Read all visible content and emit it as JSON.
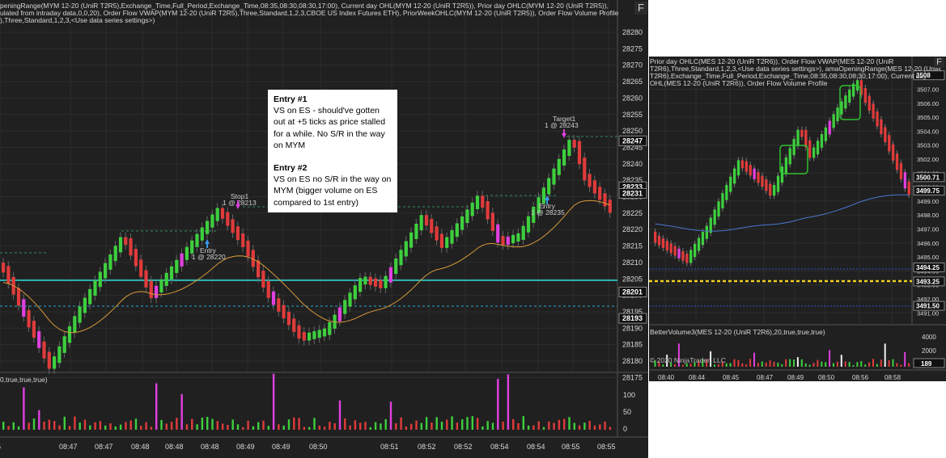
{
  "left_chart": {
    "header_lines": [
      "peningRange(MYM 12-20 (UniR T2R5),Exchange_Time,Full_Period,Exchange_Time,08:35,08:30,08:30,17:00), Current day OHL(MYM 12-20 (UniR T2R5)), Prior day OHLC(MYM 12-20 (UniR T2R5)),",
      "ulated from intraday data,0,0,20), Order Flow VWAP(MYM 12-20 (UniR T2R5),Three,Standard,1,2,3,CBOE US Index Futures ETH), PriorWeekOHLC(MYM 12-20 (UniR T2R5)), Order Flow Volume Profile",
      "),Three,Standard,1,2,3,<Use data series settings>)"
    ],
    "f_button": "F",
    "price_axis": [
      "28280",
      "28275",
      "28270",
      "28265",
      "28260",
      "28255",
      "28250",
      "28245",
      "28240",
      "28235",
      "28230",
      "28225",
      "28220",
      "28215",
      "28210",
      "28205",
      "28200",
      "28195",
      "28190",
      "28185",
      "28180",
      "28175"
    ],
    "price_markers": [
      {
        "value": "28247",
        "color": "#ffffff"
      },
      {
        "value": "28233",
        "color": "#ffffff"
      },
      {
        "value": "28231",
        "color": "#ffffff"
      },
      {
        "value": "28201",
        "color": "#ffffff"
      },
      {
        "value": "28193",
        "color": "#ffffff"
      }
    ],
    "time_axis": [
      "6",
      "08:47",
      "08:47",
      "08:48",
      "08:48",
      "08:48",
      "08:49",
      "08:49",
      "08:50",
      "08:51",
      "08:52",
      "08:52",
      "08:54",
      "08:54",
      "08:55",
      "08:55"
    ],
    "volume_header": "0,true,true,true)",
    "volume_axis": [
      "100",
      "50",
      "0"
    ],
    "annotations": [
      {
        "text": "Stop1",
        "sub": "1 @ 28213"
      },
      {
        "text": "Entry",
        "sub": "1 @ 28220"
      },
      {
        "text": "Target1",
        "sub": "1 @ 28243"
      },
      {
        "text": "Entry",
        "sub": "1 @ 28235"
      }
    ]
  },
  "info_box": {
    "title1": "Entry #1",
    "body1": "VS on ES  - should've gotten out at +5 ticks as price stalled for a while. No S/R in the way on MYM",
    "title2": "Entry #2",
    "body2": "VS on ES no S/R in the way on MYM (bigger volume on ES compared to 1st entry)"
  },
  "right_chart": {
    "header_lines": [
      "Prior day OHLC(MES 12-20 (UniR T2R6)), Order Flow VWAP(MES 12-20 (UniR",
      "T2R6),Three,Standard,1,2,3,<Use data series settings>), amaOpeningRange(MES 12-20 (UniR",
      "T2R6),Exchange_Time,Full_Period,Exchange_Time,08:35,08:30,08:30,17:00), Current day",
      "OHL(MES 12-20 (UniR T2R6)), Order Flow Volume Profile"
    ],
    "f_button": "F",
    "price_axis": [
      "3508.00",
      "3507.00",
      "3506.00",
      "3505.00",
      "3504.00",
      "3503.00",
      "3502.00",
      "3501.00",
      "3500.00",
      "3499.00",
      "3498.00",
      "3497.00",
      "3496.00",
      "3495.00",
      "3494.00",
      "3493.00",
      "3492.00",
      "3491.00"
    ],
    "price_markers": [
      {
        "value": "3508",
        "color": "#ffffff"
      },
      {
        "value": "3500.71",
        "color": "#ffffff"
      },
      {
        "value": "3499.75",
        "color": "#ffffff"
      },
      {
        "value": "3494.25",
        "color": "#ffffff"
      },
      {
        "value": "3493.25",
        "color": "#ffffff"
      },
      {
        "value": "3491.50",
        "color": "#ffffff"
      }
    ],
    "volume_header": "BetterVolume3(MES 12-20 (UniR T2R6),20,true,true,true)",
    "volume_axis": [
      "4000",
      "2000"
    ],
    "volume_marker": "189",
    "copyright": "© 2020 NinjaTrader, LLC",
    "time_axis": [
      "08:40",
      "08:44",
      "08:45",
      "08:47",
      "08:49",
      "08:50",
      "08:56",
      "08:58"
    ]
  }
}
